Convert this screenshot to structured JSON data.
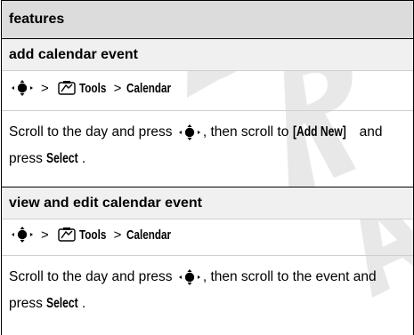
{
  "header": {
    "title": "features"
  },
  "sections": [
    {
      "title": "add calendar event",
      "path": {
        "gt1": ">",
        "menu": "Tools",
        "gt2": ">",
        "item": "Calendar"
      },
      "desc": {
        "p1": "Scroll to the day and press",
        "p2": ", then scroll to",
        "ui1": "[Add New]",
        "p3": "and press",
        "ui2": "Select",
        "p4": "."
      }
    },
    {
      "title": "view and edit calendar event",
      "path": {
        "gt1": ">",
        "menu": "Tools",
        "gt2": ">",
        "item": "Calendar"
      },
      "desc": {
        "p1": "Scroll to the day and press",
        "p2": ", then scroll to the",
        "p3": "event and press",
        "ui2": "Select",
        "p4": "."
      }
    }
  ],
  "watermark": {
    "text": "DRAFT",
    "color": "#e8e8e8"
  },
  "icons": [
    "nav-key-icon",
    "tools-icon"
  ]
}
